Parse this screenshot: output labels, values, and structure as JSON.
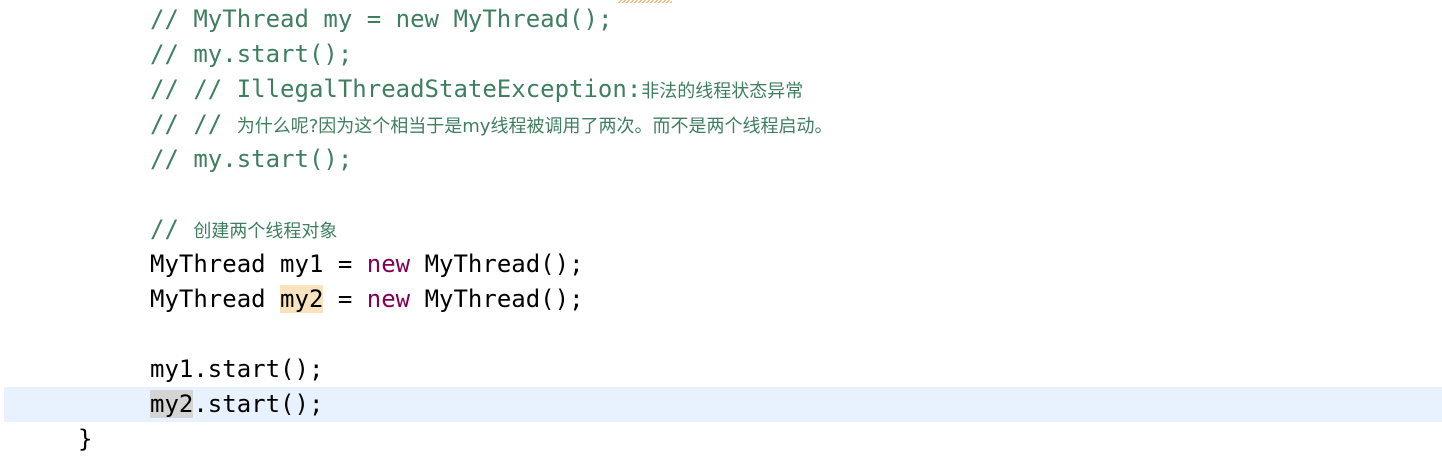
{
  "editor": {
    "lines": [
      {
        "prefix": "// ",
        "code": "MyThread my = new MyThread();"
      },
      {
        "prefix": "// ",
        "code": "my.start();"
      },
      {
        "prefix": "// // ",
        "code": "IllegalThreadStateException:",
        "cjk": "非法的线程状态异常"
      },
      {
        "prefix": "// // ",
        "cjk": "为什么呢?因为这个相当于是my线程被调用了两次。而不是两个线程启动。"
      },
      {
        "prefix": "// ",
        "code": "my.start();"
      },
      {
        "prefix": "// ",
        "cjk": "创建两个线程对象"
      }
    ],
    "decl1": {
      "type": "MyThread ",
      "var": "my1",
      "eq": " = ",
      "kw": "new",
      "rest": " MyThread();"
    },
    "decl2": {
      "type": "MyThread ",
      "var": "my2",
      "eq": " = ",
      "kw": "new",
      "rest": " MyThread();"
    },
    "call1": {
      "var": "my1",
      "rest": ".start();"
    },
    "call2": {
      "var": "my2",
      "rest": ".start();"
    },
    "closing_brace": "}",
    "colors": {
      "comment": "#3f7f5f",
      "keyword": "#7f0055",
      "current_line": "#e8f2fe",
      "write_occurrence": "#f9e3be",
      "read_occurrence": "#d4d4d4"
    }
  }
}
